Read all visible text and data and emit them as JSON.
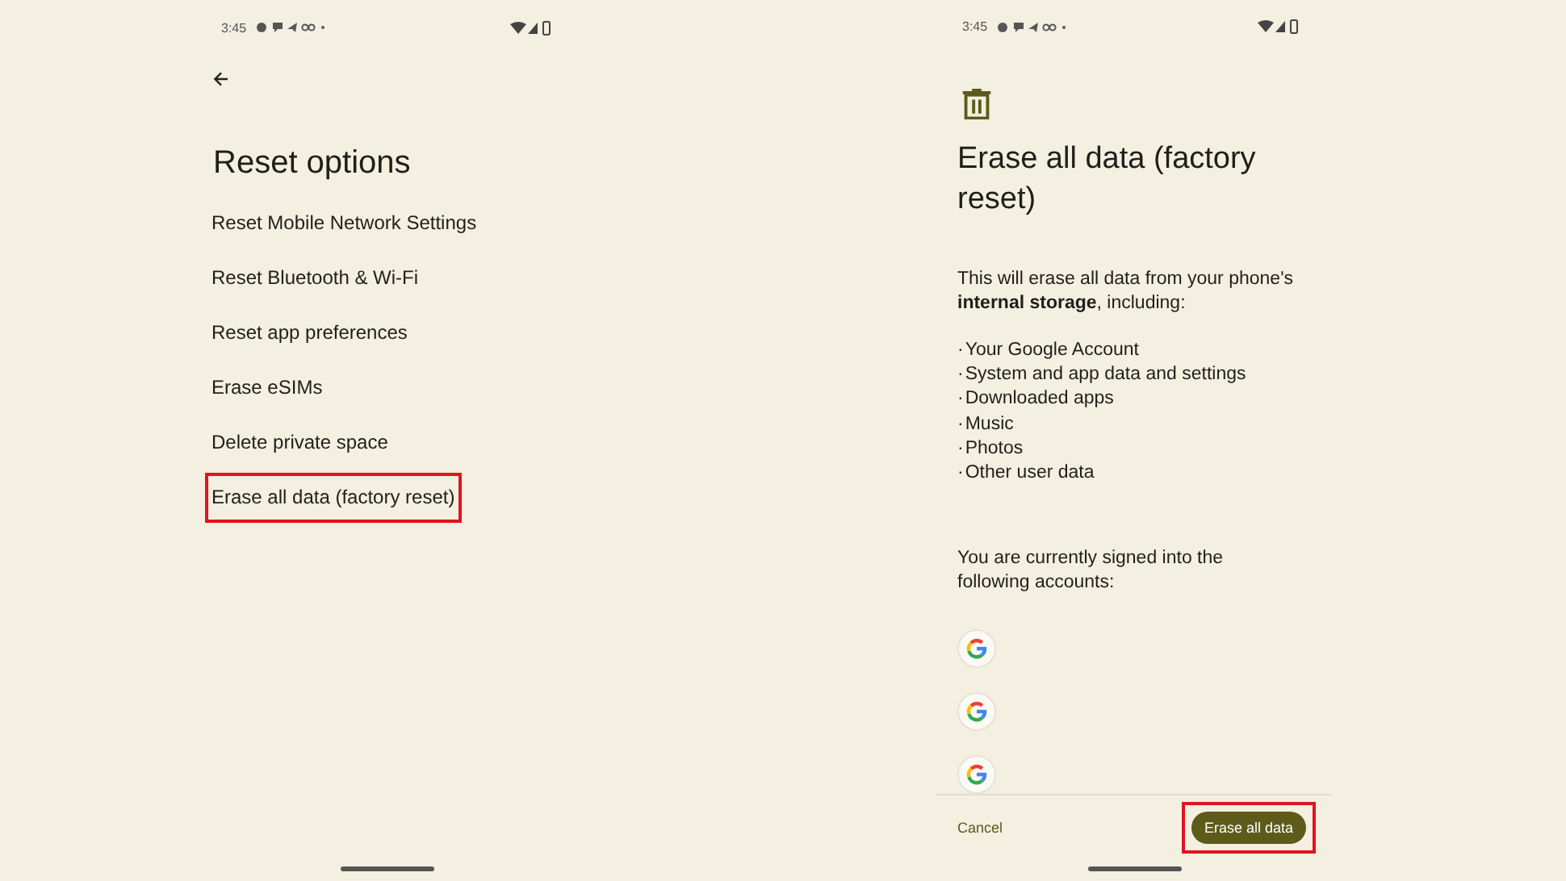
{
  "screens": [
    {
      "kind": "reset_options",
      "status_bar": {
        "time": "3:45"
      },
      "title": "Reset options",
      "items": [
        {
          "label": "Reset Mobile Network Settings",
          "highlighted": false
        },
        {
          "label": "Reset Bluetooth & Wi-Fi",
          "highlighted": false
        },
        {
          "label": "Reset app preferences",
          "highlighted": false
        },
        {
          "label": "Erase eSIMs",
          "highlighted": false
        },
        {
          "label": "Delete private space",
          "highlighted": false
        },
        {
          "label": "Erase all data (factory reset)",
          "highlighted": true
        }
      ]
    },
    {
      "kind": "erase_confirm",
      "status_bar": {
        "time": "3:45"
      },
      "title": "Erase all data (factory reset)",
      "description": "This will erase all data from your phone's **internal storage**, including:",
      "bullets": [
        {
          "bullet": "·",
          "text": "Your Google Account"
        },
        {
          "bullet": "·",
          "text": "System and app data and settings"
        },
        {
          "bullet": "·",
          "text": "Downloaded apps"
        },
        {
          "bullet": "·",
          "text": "Music"
        },
        {
          "bullet": "·",
          "text": "Photos"
        },
        {
          "bullet": "·",
          "text": "Other user data"
        }
      ],
      "accounts_note": "You are currently signed into the following accounts:",
      "accounts": [
        {
          "kind": "google"
        },
        {
          "kind": "google"
        },
        {
          "kind": "google"
        }
      ],
      "cancel": {
        "label": "Cancel",
        "highlighted": false
      },
      "confirm": {
        "label": "Erase all data",
        "highlighted": true
      }
    }
  ]
}
